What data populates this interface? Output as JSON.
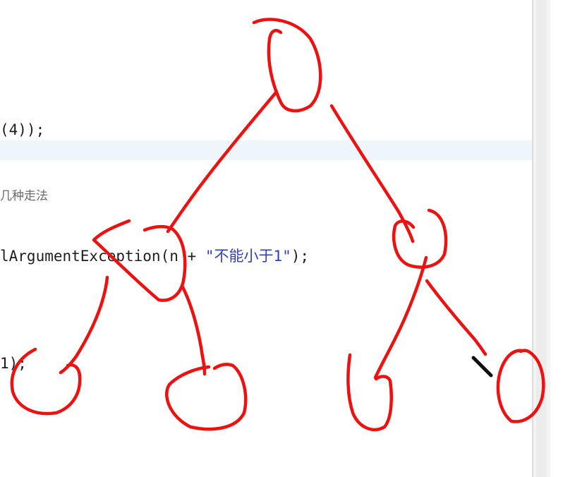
{
  "editor": {
    "lines": [
      {
        "text": "(4));"
      },
      {
        "text": "几种走法"
      },
      {
        "pre": "lArgumentException(",
        "mid": "n",
        "post": " + ",
        "string": "\"不能小于1\"",
        "tail": ");"
      },
      {
        "text": "1);"
      }
    ]
  },
  "annotation": {
    "ink_color": "#ef1010",
    "description_icon": "pen-cursor-icon"
  }
}
